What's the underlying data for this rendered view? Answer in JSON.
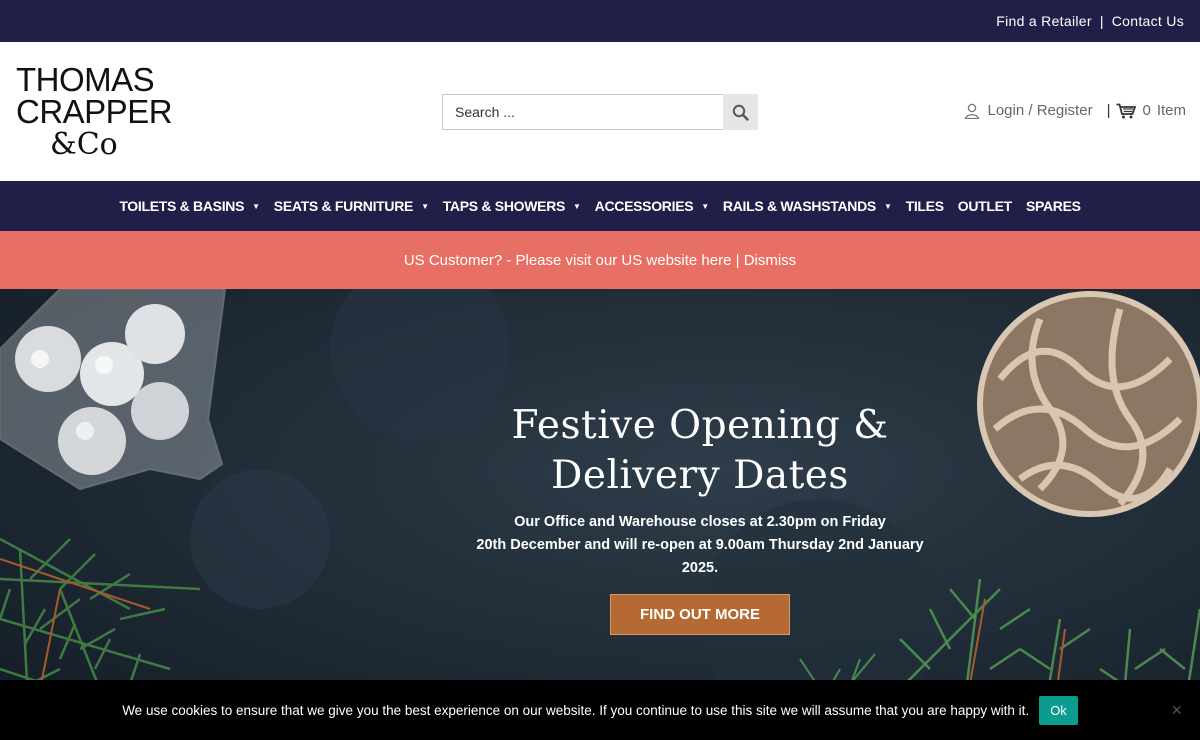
{
  "topbar": {
    "find_retailer": "Find a Retailer",
    "separator": "|",
    "contact": "Contact Us"
  },
  "logo": {
    "line1": "THOMAS",
    "line2": "CRAPPER",
    "line3": "&Co"
  },
  "search": {
    "placeholder": "Search ..."
  },
  "account": {
    "login": "Login / Register",
    "separator": "|",
    "cart_count": "0",
    "cart_label": "Item"
  },
  "nav": [
    {
      "label": "TOILETS & BASINS",
      "dropdown": true
    },
    {
      "label": "SEATS & FURNITURE",
      "dropdown": true
    },
    {
      "label": "TAPS & SHOWERS",
      "dropdown": true
    },
    {
      "label": "ACCESSORIES",
      "dropdown": true
    },
    {
      "label": "RAILS & WASHSTANDS",
      "dropdown": true
    },
    {
      "label": "TILES",
      "dropdown": false
    },
    {
      "label": "OUTLET",
      "dropdown": false
    },
    {
      "label": "SPARES",
      "dropdown": false
    }
  ],
  "notice": {
    "text": "US Customer? - Please visit our US website here",
    "separator": " | ",
    "dismiss": "Dismiss"
  },
  "hero": {
    "title_line1": "Festive Opening &",
    "title_line2": "Delivery Dates",
    "body_line1": "Our Office and Warehouse closes at 2.30pm on Friday",
    "body_line2": "20th December and will re-open at 9.00am Thursday 2nd January",
    "body_line3": "2025.",
    "cta": "FIND OUT MORE"
  },
  "cookie": {
    "text": "We use cookies to ensure that we give you the best experience on our website. If you continue to use this site we will assume that you are happy with it.",
    "ok": "Ok",
    "close": "×"
  },
  "colors": {
    "navy": "#211f47",
    "notice": "#e76f63",
    "cta": "#b56a33",
    "cookie_ok": "#0a9c8f"
  }
}
